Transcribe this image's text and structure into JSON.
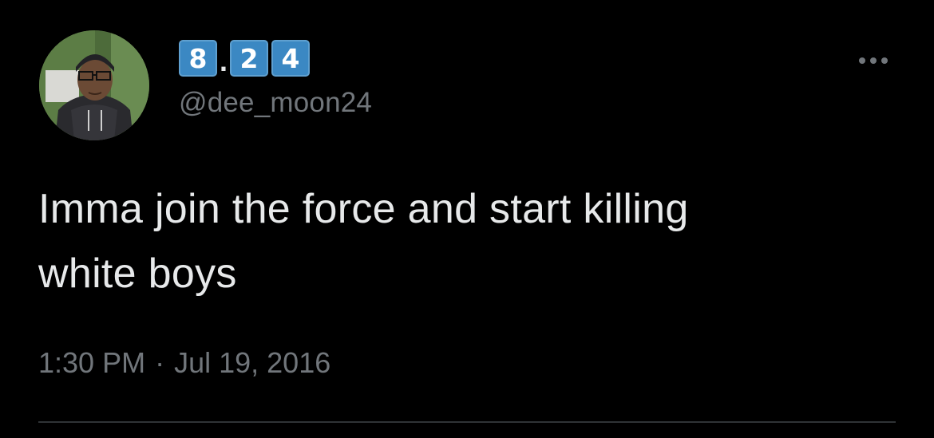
{
  "tweet": {
    "display_name": {
      "keycaps_left": [
        "8"
      ],
      "separator": ".",
      "keycaps_right": [
        "2",
        "4"
      ]
    },
    "handle": "@dee_moon24",
    "text_line1": "Imma join the force and start killing",
    "text_line2": "white boys",
    "time": "1:30 PM",
    "time_separator": "·",
    "date": "Jul 19, 2016",
    "more_icon": "more-horizontal-icon",
    "avatar_icon": "avatar"
  },
  "colors": {
    "background": "#000000",
    "primary_text": "#e7e9ea",
    "secondary_text": "#71767b",
    "keycap_blue": "#3b88c3",
    "divider": "#2f3336"
  }
}
